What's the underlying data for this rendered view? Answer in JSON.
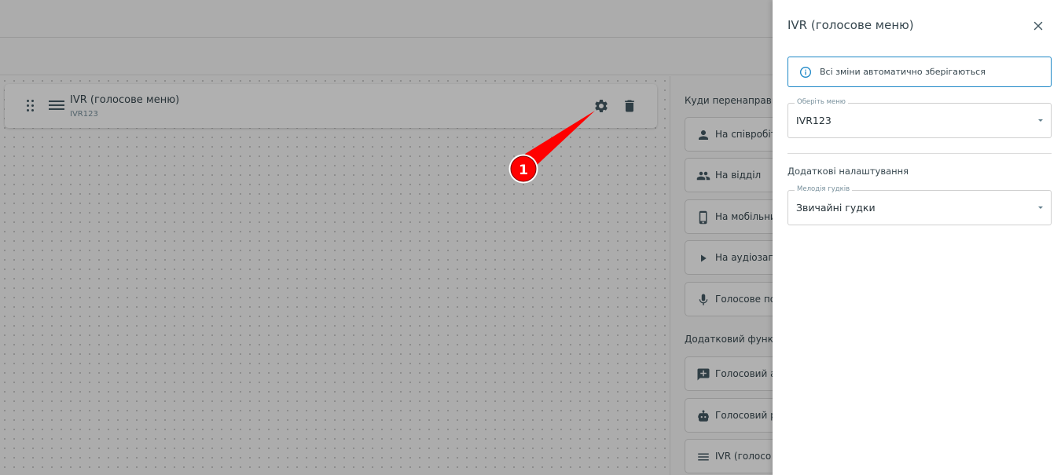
{
  "node": {
    "title": "IVR (голосове меню)",
    "subtitle": "IVR123"
  },
  "redirect_section": {
    "label": "Куди перенаправи",
    "options": [
      {
        "label": "На співробіт",
        "icon": "person-icon"
      },
      {
        "label": "На відділ",
        "icon": "group-icon"
      },
      {
        "label": "На мобільни",
        "icon": "mobile-phone-icon"
      },
      {
        "label": "На аудіозап",
        "icon": "play-icon"
      },
      {
        "label": "Голосове по",
        "icon": "microphone-icon"
      }
    ]
  },
  "extra_section": {
    "label": "Додатковий функц",
    "options": [
      {
        "label": "Голосовий а",
        "icon": "chat-plus-icon"
      },
      {
        "label": "Голосовий р",
        "icon": "robot-icon"
      },
      {
        "label": "IVR (голосо",
        "icon": "menu-lines-icon"
      }
    ]
  },
  "annotation": {
    "step": "1"
  },
  "drawer": {
    "title": "IVR (голосове меню)",
    "info": "Всі зміни автоматично зберігаються",
    "menu_field": {
      "legend": "Оберіть меню",
      "value": "IVR123"
    },
    "extra_title": "Додаткові налаштування",
    "melody_field": {
      "legend": "Мелодія гудків",
      "value": "Звичайні гудки"
    }
  },
  "colors": {
    "accent": "#1e88c7",
    "annotation": "#ff0000",
    "overlay": "rgba(0,0,0,0.31)"
  }
}
